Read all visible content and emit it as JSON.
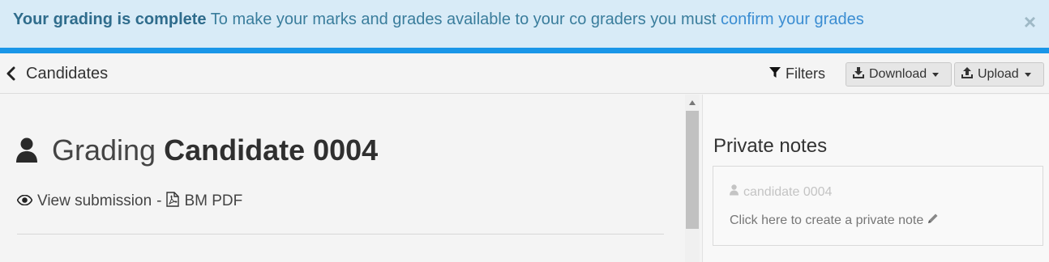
{
  "alert": {
    "title": "Your grading is complete",
    "message": "To make your marks and grades available to your co graders you must",
    "link": "confirm your grades",
    "close_symbol": "×",
    "accent_color": "#1a96e8",
    "close_icon": "close-icon"
  },
  "toolbar": {
    "back_label": "Candidates",
    "back_icon": "chevron-left-icon",
    "filters_label": "Filters",
    "filters_icon": "filter-icon",
    "download_label": "Download",
    "download_icon": "download-icon",
    "upload_label": "Upload",
    "upload_icon": "upload-icon"
  },
  "main": {
    "grading_label": "Grading",
    "candidate_name": "Candidate 0004",
    "user_icon": "user-icon",
    "view_submission_label": "View submission",
    "separator": "-",
    "pdf_label": "BM PDF",
    "view_icon": "eye-icon",
    "pdf_icon": "pdf-file-icon"
  },
  "notes": {
    "title": "Private notes",
    "user_label": "candidate 0004",
    "create_label": "Click here to create a private note",
    "edit_icon": "pencil-icon"
  }
}
